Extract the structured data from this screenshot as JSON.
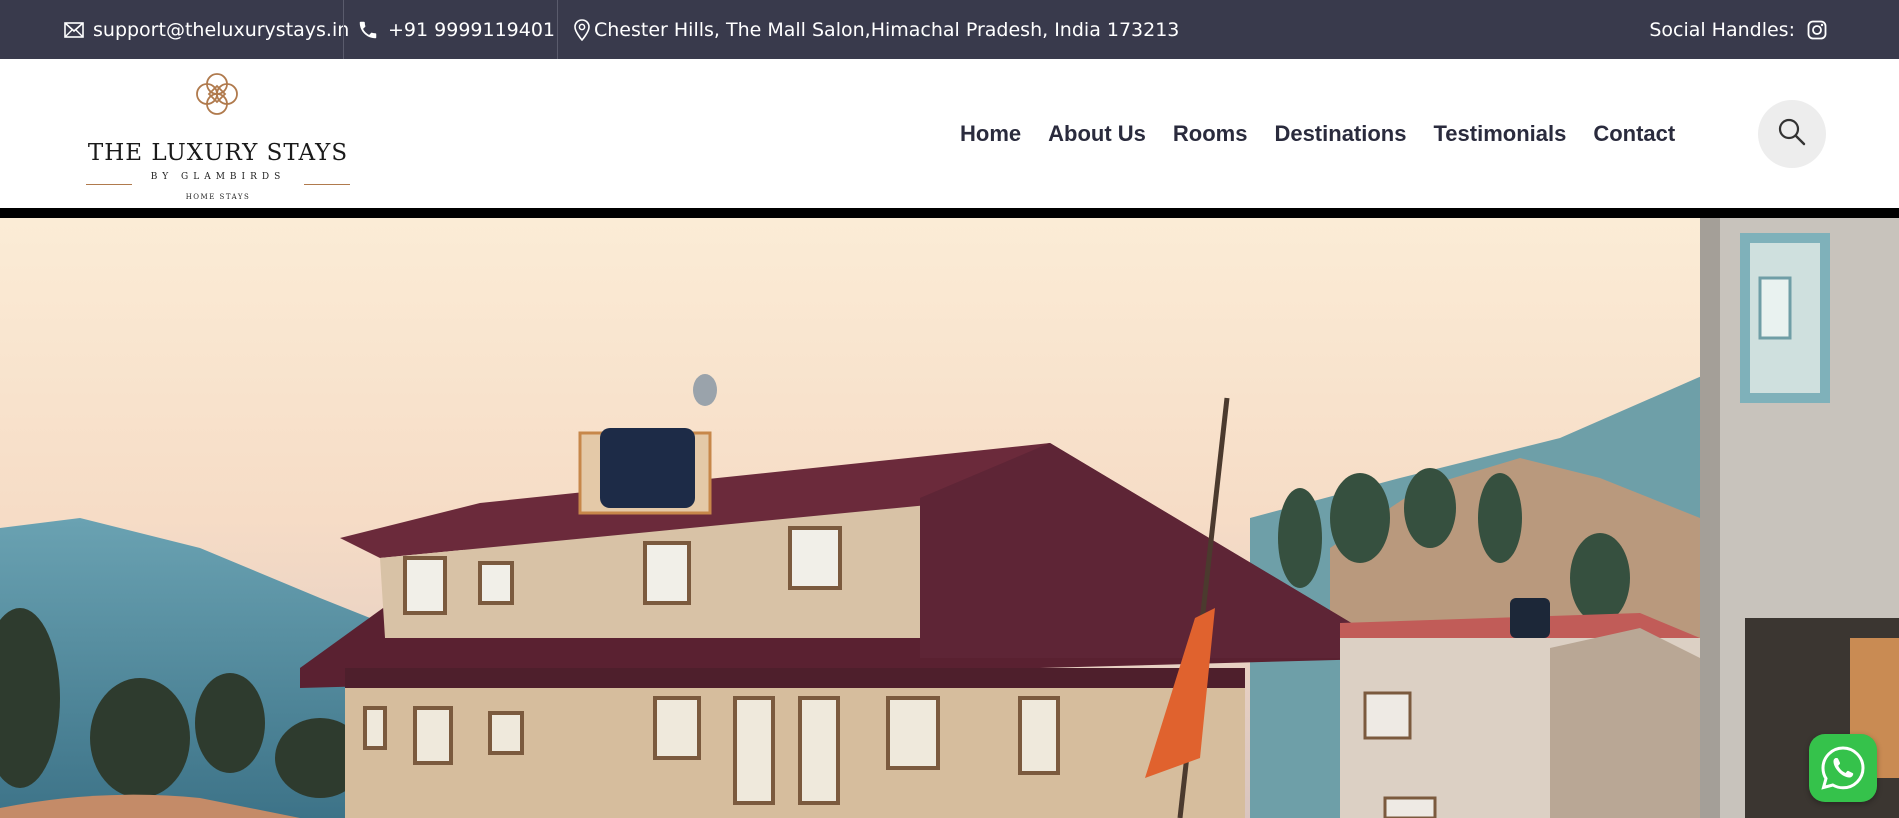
{
  "topbar": {
    "email": "support@theluxurystays.in",
    "phone": "+91 9999119401",
    "address": "Chester Hills, The Mall Salon,Himachal Pradesh, India 173213",
    "social_label": "Social Handles:"
  },
  "logo": {
    "title": "THE LUXURY STAYS",
    "subtitle": "BY GLAMBIRDS",
    "tagline": "HOME STAYS"
  },
  "nav": {
    "items": [
      "Home",
      "About Us",
      "Rooms",
      "Destinations",
      "Testimonials",
      "Contact"
    ]
  },
  "icons": {
    "email": "mail-icon",
    "phone": "phone-icon",
    "address": "map-pin-icon",
    "social": "instagram-icon",
    "search": "search-icon",
    "chat": "whatsapp-icon"
  },
  "colors": {
    "topbar_bg": "#393a4c",
    "nav_text": "#2a2b3d",
    "logo_accent": "#b07a4d",
    "whatsapp": "#35c24b"
  }
}
